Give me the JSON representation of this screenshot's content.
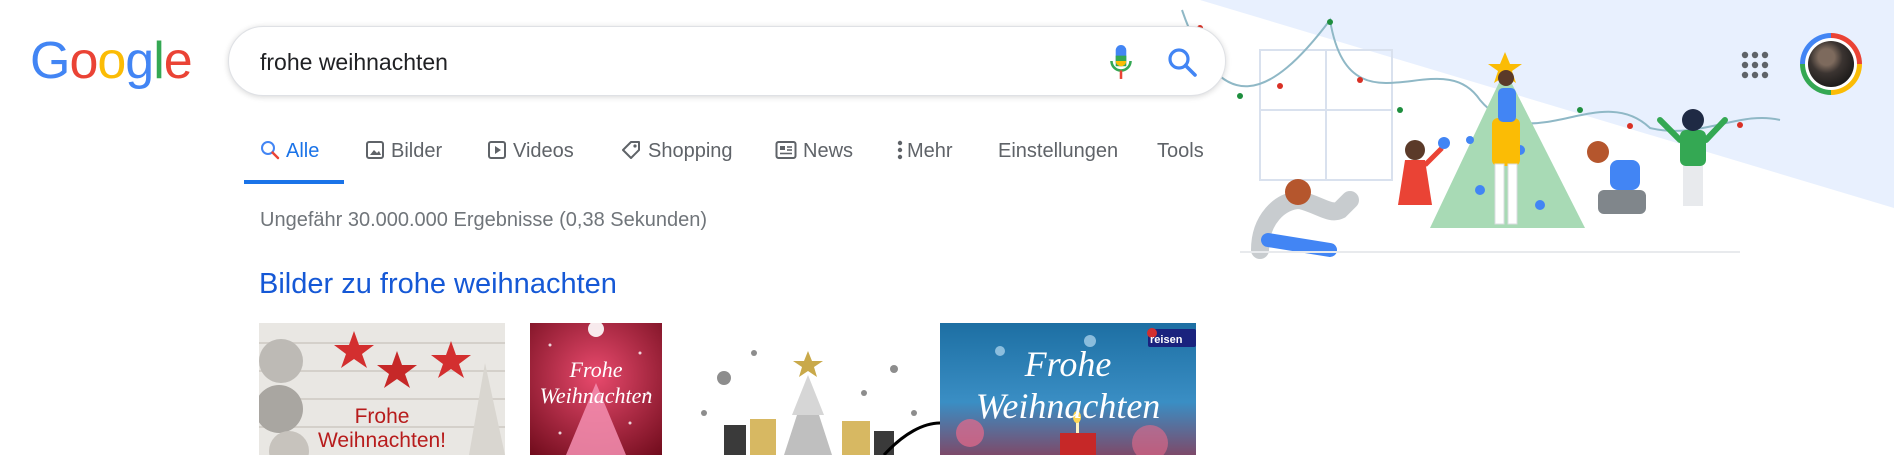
{
  "logo": {
    "letters": [
      "G",
      "o",
      "o",
      "g",
      "l",
      "e"
    ]
  },
  "search": {
    "query": "frohe weihnachten",
    "placeholder": ""
  },
  "tabs": [
    {
      "label": "Alle",
      "icon": "search-icon",
      "active": true
    },
    {
      "label": "Bilder",
      "icon": "image-icon",
      "active": false
    },
    {
      "label": "Videos",
      "icon": "video-icon",
      "active": false
    },
    {
      "label": "Shopping",
      "icon": "tag-icon",
      "active": false
    },
    {
      "label": "News",
      "icon": "news-icon",
      "active": false
    },
    {
      "label": "Mehr",
      "icon": "more-vert-icon",
      "active": false
    },
    {
      "label": "Einstellungen",
      "icon": "",
      "active": false
    },
    {
      "label": "Tools",
      "icon": "",
      "active": false
    }
  ],
  "results": {
    "stats": "Ungefähr 30.000.000 Ergebnisse (0,38 Sekunden)",
    "images_heading": "Bilder zu frohe weihnachten"
  },
  "thumbnails": [
    {
      "text_lines": [
        "Frohe",
        "Weihnachten!"
      ]
    },
    {
      "text_lines": [
        "Frohe",
        "Weihnachten"
      ]
    },
    {
      "text_lines": []
    },
    {
      "text_lines": [
        "Frohe",
        "Weihnachten"
      ],
      "badge": "reisen"
    }
  ],
  "colors": {
    "accent": "#1a73e8",
    "link": "#1558d6",
    "muted": "#70757a",
    "tab_text": "#5f6368"
  }
}
